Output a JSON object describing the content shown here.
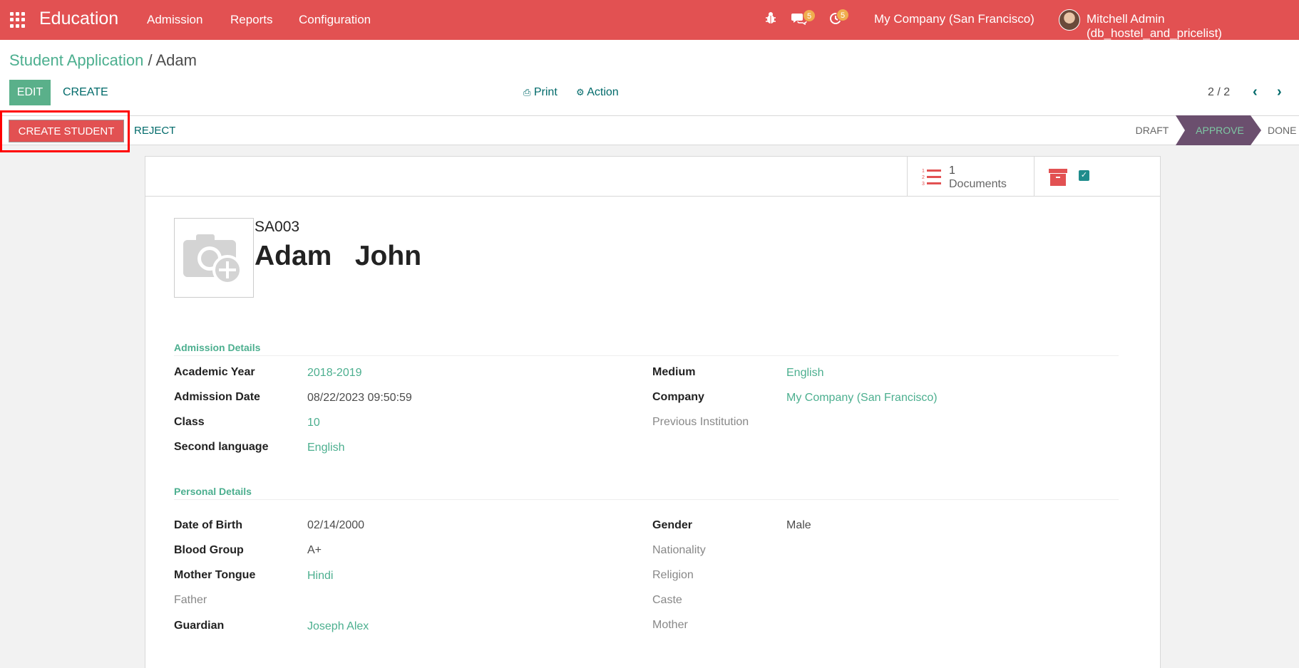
{
  "navbar": {
    "brand": "Education",
    "menu": [
      "Admission",
      "Reports",
      "Configuration"
    ],
    "messages_count": "5",
    "activities_count": "5",
    "company": "My Company (San Francisco)",
    "user": "Mitchell Admin (db_hostel_and_pricelist)",
    "bg_color": "#e25152"
  },
  "breadcrumb": {
    "parent": "Student Application",
    "separator": " / ",
    "current": "Adam"
  },
  "toolbar": {
    "edit_label": "EDIT",
    "create_label": "CREATE",
    "print_label": "Print",
    "action_label": "Action",
    "pager": "2 / 2"
  },
  "statusbar": {
    "create_student_label": "CREATE STUDENT",
    "reject_label": "REJECT",
    "stages": [
      "DRAFT",
      "APPROVE",
      "DONE"
    ],
    "active_stage": "APPROVE"
  },
  "button_box": {
    "documents_count": "1",
    "documents_label": "Documents"
  },
  "record": {
    "code": "SA003",
    "name": "Adam   John"
  },
  "admission": {
    "title": "Admission Details",
    "left": [
      {
        "label": "Academic Year",
        "value": "2018-2019"
      },
      {
        "label": "Admission Date",
        "value": "08/22/2023 09:50:59"
      },
      {
        "label": "Class",
        "value": "10"
      },
      {
        "label": "Second language",
        "value": "English"
      }
    ],
    "right": [
      {
        "label": "Medium",
        "value": "English"
      },
      {
        "label": "Company",
        "value": "My Company (San Francisco)"
      },
      {
        "label": "Previous Institution",
        "value": ""
      }
    ]
  },
  "personal": {
    "title": "Personal Details",
    "left": [
      {
        "label": "Date of Birth",
        "value": "02/14/2000"
      },
      {
        "label": "Blood Group",
        "value": "A+"
      },
      {
        "label": "Mother Tongue",
        "value": "Hindi"
      },
      {
        "label": "Father",
        "value": ""
      },
      {
        "label": "Guardian",
        "value": "Joseph Alex"
      }
    ],
    "right": [
      {
        "label": "Gender",
        "value": "Male"
      },
      {
        "label": "Nationality",
        "value": ""
      },
      {
        "label": "Religion",
        "value": ""
      },
      {
        "label": "Caste",
        "value": ""
      },
      {
        "label": "Mother",
        "value": ""
      }
    ]
  }
}
